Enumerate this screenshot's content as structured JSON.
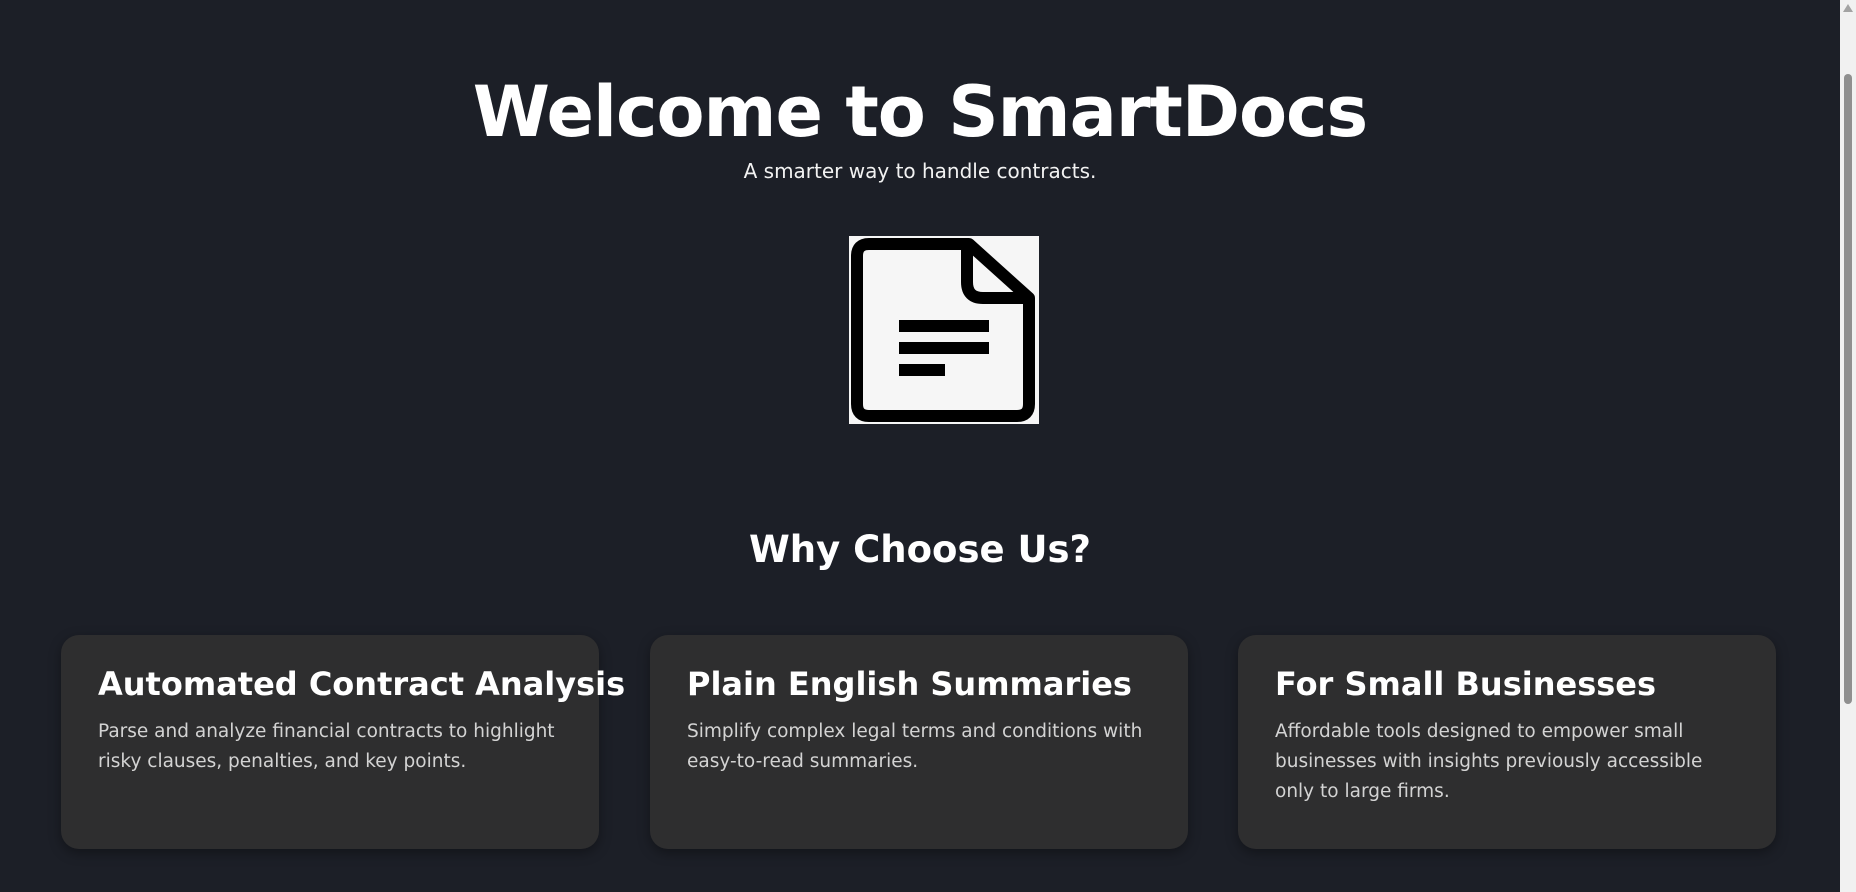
{
  "hero": {
    "title": "Welcome to SmartDocs",
    "subtitle": "A smarter way to handle contracts.",
    "logo_icon": "document-icon"
  },
  "features": {
    "heading": "Why Choose Us?",
    "cards": [
      {
        "title": "Automated Contract Analysis",
        "text": "Parse and analyze financial contracts to highlight risky clauses, penalties, and key points."
      },
      {
        "title": "Plain English Summaries",
        "text": "Simplify complex legal terms and conditions with easy-to-read summaries."
      },
      {
        "title": "For Small Businesses",
        "text": "Affordable tools designed to empower small businesses with insights previously accessible only to large firms."
      }
    ]
  },
  "colors": {
    "background": "#1c1f27",
    "card": "#2e2e2f",
    "text": "#ffffff",
    "muted_text": "#d3d3d3"
  }
}
